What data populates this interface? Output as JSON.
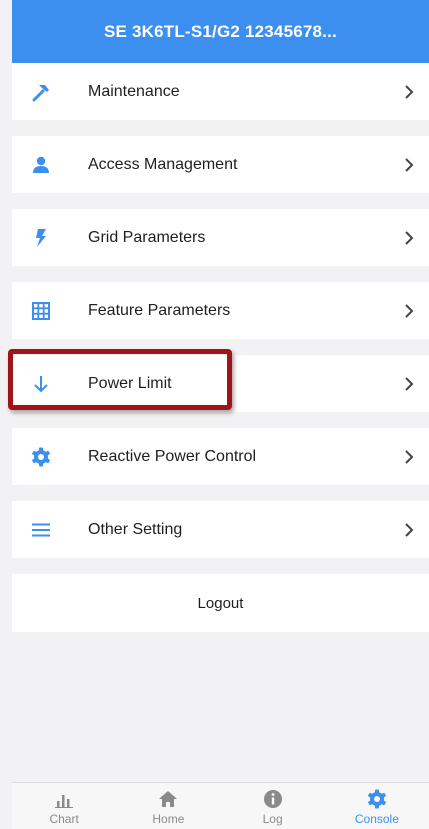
{
  "header": {
    "title": "SE 3K6TL-S1/G2 12345678..."
  },
  "menu": {
    "items": [
      {
        "label": "Maintenance",
        "icon": "hammer-icon"
      },
      {
        "label": "Access Management",
        "icon": "person-icon"
      },
      {
        "label": "Grid Parameters",
        "icon": "lightning-icon"
      },
      {
        "label": "Feature Parameters",
        "icon": "grid-icon"
      },
      {
        "label": "Power Limit",
        "icon": "arrow-down-icon"
      },
      {
        "label": "Reactive Power Control",
        "icon": "gear-icon"
      },
      {
        "label": "Other Setting",
        "icon": "hamburger-icon"
      }
    ]
  },
  "logout": {
    "label": "Logout"
  },
  "tabbar": {
    "tabs": [
      {
        "label": "Chart",
        "icon": "bar-chart-icon"
      },
      {
        "label": "Home",
        "icon": "home-icon"
      },
      {
        "label": "Log",
        "icon": "info-icon"
      },
      {
        "label": "Console",
        "icon": "gear-icon",
        "active": true
      }
    ]
  },
  "colors": {
    "accent": "#3d8fef",
    "highlight_box": "#a01418",
    "background": "#f2f2f4"
  }
}
